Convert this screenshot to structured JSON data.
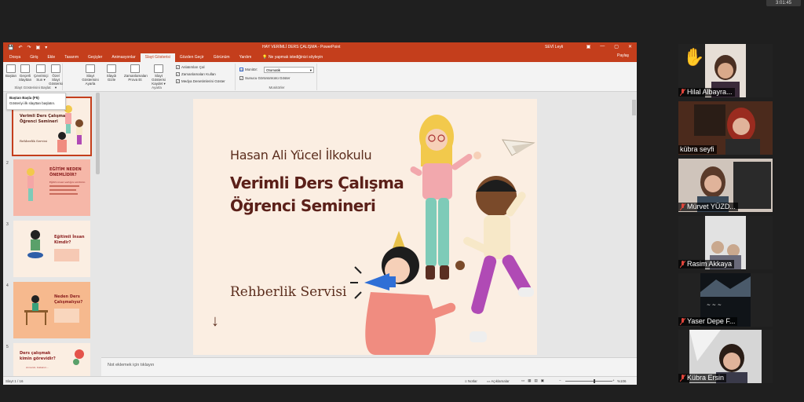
{
  "top_tag": "3:01:45",
  "powerpoint": {
    "quick_access": [
      "💾",
      "↶",
      "↷",
      "▣",
      "▾"
    ],
    "title": "HAY VERİMLİ DERS ÇALIŞMA  -  PowerPoint",
    "user": "SEVİ Leyli",
    "window_buttons": [
      "▣",
      "—",
      "▢",
      "✕"
    ],
    "tabs": [
      "Dosya",
      "Giriş",
      "Ekle",
      "Tasarım",
      "Geçişler",
      "Animasyonlar",
      "Slayt Gösterisi",
      "Gözden Geçir",
      "Görünüm",
      "Yardım"
    ],
    "active_tab": "Slayt Gösterisi",
    "search_label": "Ne yapmak istediğinizi söyleyin",
    "share_label": "Paylaş",
    "ribbon": {
      "buttons": [
        {
          "label1": "Baştan",
          "label2": ""
        },
        {
          "label1": "Geçerli",
          "label2": "Slayttan"
        },
        {
          "label1": "Çevrimiçi",
          "label2": "Sun ▾"
        },
        {
          "label1": "Özel Slayt",
          "label2": "Gösterisi ▾"
        },
        {
          "label1": "Slayt Gösterisini",
          "label2": "Ayarla"
        },
        {
          "label1": "Slaydı",
          "label2": "Gizle"
        },
        {
          "label1": "Zamanlamaları",
          "label2": "Prova Et"
        },
        {
          "label1": "Slayt Gösterisi",
          "label2": "Kaydet ▾"
        }
      ],
      "group_start": "Slayt Gösterisini Başlat",
      "group_setup": "Ayarla",
      "group_monitors": "Monitörler",
      "checks": [
        "Anlatımları Çal",
        "Zamanlamaları Kullan",
        "Medya Denetimlerini Göster"
      ],
      "monitor_label": "Monitör:",
      "monitor_value": "Otomatik",
      "presenter_view": "Sunucu Görünümünü Göster"
    },
    "tooltip": {
      "title": "Baştan Başla (F5)",
      "body": "Gösteriyi ilk slayttan başlatın."
    },
    "thumbnails": [
      {
        "num": "1",
        "line1": "Hasan Ali Yücel İlkokulu",
        "line2": "Verimli Ders Çalışma",
        "line3": "Öğrenci Semineri",
        "line4": "Rehberlik Servisi"
      },
      {
        "num": "2",
        "line1": "EĞİTİM NEDEN",
        "line2": "ÖNEMLİDİR?",
        "line3": "Eğitim insan varlığını sürdürür.",
        "line4": ""
      },
      {
        "num": "3",
        "line1": "Eğitimli İnsan",
        "line2": "Kimdir?",
        "line3": "",
        "line4": ""
      },
      {
        "num": "4",
        "line1": "Neden Ders",
        "line2": "Çalışmalıyız?",
        "line3": "",
        "line4": ""
      },
      {
        "num": "5",
        "line1": "Ders çalışmak",
        "line2": "kimin görevidir?",
        "line3": "Anneniz, babanız...",
        "line4": ""
      }
    ],
    "slide": {
      "school": "Hasan Ali Yücel İlkokulu",
      "title_line1": "Verimli Ders Çalışma",
      "title_line2": "Öğrenci Semineri",
      "service": "Rehberlik Servisi",
      "arrow": "↓"
    },
    "notes_placeholder": "Not eklemek için tıklayın",
    "status": {
      "slide_counter": "Slayt 1 / 16",
      "notes_button": "Notlar",
      "comments_button": "Açıklamalar",
      "zoom": "%106"
    }
  },
  "participants": [
    {
      "name": "Hilal Albayra...",
      "hand": "✋"
    },
    {
      "name": "kübra seyfi",
      "hand": ""
    },
    {
      "name": "Mürvet YÜZD...",
      "hand": ""
    },
    {
      "name": "Rasim Akkaya",
      "hand": ""
    },
    {
      "name": "Yaser Depe F...",
      "hand": ""
    },
    {
      "name": "Kübra Ersin",
      "hand": ""
    }
  ]
}
